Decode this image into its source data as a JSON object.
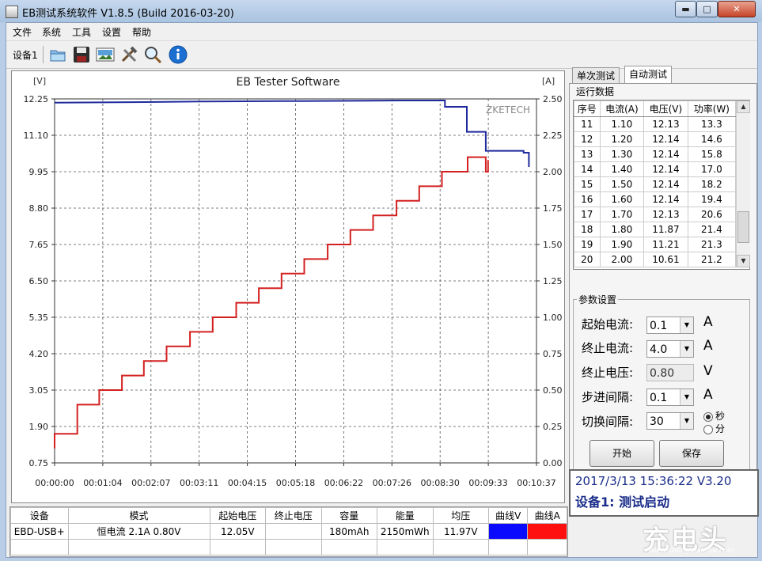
{
  "window": {
    "title": "EB测试系统软件 V1.8.5 (Build 2016-03-20)",
    "min_glyph": "▬",
    "max_glyph": "□",
    "close_glyph": "✕"
  },
  "menu": [
    "文件",
    "系统",
    "工具",
    "设置",
    "帮助"
  ],
  "toolbar": {
    "device_label": "设备1",
    "buttons": [
      "folder-icon",
      "save-icon",
      "image-icon",
      "tools-icon",
      "search-icon",
      "info-icon"
    ]
  },
  "chart_data": {
    "type": "line",
    "title": "EB Tester Software",
    "watermark": "ZKETECH",
    "left_unit": "[V]",
    "right_unit": "[A]",
    "x_tick_labels": [
      "00:00:00",
      "00:01:04",
      "00:02:07",
      "00:03:11",
      "00:04:15",
      "00:05:18",
      "00:06:22",
      "00:07:26",
      "00:08:30",
      "00:09:33",
      "00:10:37"
    ],
    "y_left_ticks": [
      "12.25",
      "11.10",
      "9.95",
      "8.80",
      "7.65",
      "6.50",
      "5.35",
      "4.20",
      "3.05",
      "1.90",
      "0.75"
    ],
    "y_right_ticks": [
      "2.50",
      "2.25",
      "2.00",
      "1.75",
      "1.50",
      "1.25",
      "1.00",
      "0.75",
      "0.50",
      "0.25",
      "0.00"
    ],
    "ylim_left": [
      0.75,
      12.25
    ],
    "ylim_right": [
      0.0,
      2.5
    ],
    "x_range_seconds": [
      0,
      637
    ],
    "series": [
      {
        "name": "曲线V",
        "axis": "left",
        "color": "#1f2a9c",
        "points": [
          [
            0,
            12.13
          ],
          [
            60,
            12.14
          ],
          [
            120,
            12.15
          ],
          [
            200,
            12.17
          ],
          [
            300,
            12.18
          ],
          [
            400,
            12.19
          ],
          [
            460,
            12.2
          ],
          [
            510,
            12.2
          ],
          [
            516,
            12.2
          ],
          [
            516,
            12.0
          ],
          [
            545,
            12.0
          ],
          [
            545,
            11.87
          ],
          [
            545,
            11.21
          ],
          [
            570,
            11.21
          ],
          [
            570,
            10.61
          ],
          [
            620,
            10.61
          ],
          [
            620,
            10.55
          ],
          [
            627,
            10.55
          ],
          [
            627,
            10.1
          ]
        ]
      },
      {
        "name": "曲线A",
        "axis": "right",
        "color": "#d42020",
        "points": [
          [
            0,
            0.1
          ],
          [
            0,
            0.2
          ],
          [
            30,
            0.2
          ],
          [
            30,
            0.4
          ],
          [
            59,
            0.4
          ],
          [
            59,
            0.5
          ],
          [
            89,
            0.5
          ],
          [
            89,
            0.6
          ],
          [
            118,
            0.6
          ],
          [
            118,
            0.7
          ],
          [
            148,
            0.7
          ],
          [
            148,
            0.8
          ],
          [
            179,
            0.8
          ],
          [
            179,
            0.9
          ],
          [
            209,
            0.9
          ],
          [
            209,
            1.0
          ],
          [
            240,
            1.0
          ],
          [
            240,
            1.1
          ],
          [
            270,
            1.1
          ],
          [
            270,
            1.2
          ],
          [
            300,
            1.2
          ],
          [
            300,
            1.3
          ],
          [
            330,
            1.3
          ],
          [
            330,
            1.4
          ],
          [
            361,
            1.4
          ],
          [
            361,
            1.5
          ],
          [
            391,
            1.5
          ],
          [
            391,
            1.6
          ],
          [
            421,
            1.6
          ],
          [
            421,
            1.7
          ],
          [
            452,
            1.7
          ],
          [
            452,
            1.8
          ],
          [
            482,
            1.8
          ],
          [
            482,
            1.9
          ],
          [
            512,
            1.9
          ],
          [
            512,
            2.0
          ],
          [
            546,
            2.0
          ],
          [
            546,
            2.1
          ],
          [
            570,
            2.1
          ],
          [
            570,
            2.0
          ],
          [
            573,
            2.0
          ],
          [
            573,
            2.08
          ]
        ]
      }
    ]
  },
  "tabs": [
    "单次测试",
    "自动测试"
  ],
  "run_data": {
    "title": "运行数据",
    "headers": [
      "序号",
      "电流(A)",
      "电压(V)",
      "功率(W)"
    ],
    "rows": [
      [
        "11",
        "1.10",
        "12.13",
        "13.3"
      ],
      [
        "12",
        "1.20",
        "12.14",
        "14.6"
      ],
      [
        "13",
        "1.30",
        "12.14",
        "15.8"
      ],
      [
        "14",
        "1.40",
        "12.14",
        "17.0"
      ],
      [
        "15",
        "1.50",
        "12.14",
        "18.2"
      ],
      [
        "16",
        "1.60",
        "12.14",
        "19.4"
      ],
      [
        "17",
        "1.70",
        "12.13",
        "20.6"
      ],
      [
        "18",
        "1.80",
        "11.87",
        "21.4"
      ],
      [
        "19",
        "1.90",
        "11.21",
        "21.3"
      ],
      [
        "20",
        "2.00",
        "10.61",
        "21.2"
      ]
    ]
  },
  "params": {
    "title": "参数设置",
    "start_current_label": "起始电流:",
    "start_current_value": "0.1",
    "start_current_unit": "A",
    "end_current_label": "终止电流:",
    "end_current_value": "4.0",
    "end_current_unit": "A",
    "end_voltage_label": "终止电压:",
    "end_voltage_value": "0.80",
    "end_voltage_unit": "V",
    "step_label": "步进间隔:",
    "step_value": "0.1",
    "step_unit": "A",
    "switch_label": "切换间隔:",
    "switch_value": "30",
    "radio_sec": "秒",
    "radio_min": "分",
    "start_button": "开始",
    "save_button": "保存"
  },
  "status": {
    "line1": "2017/3/13 15:36:22  V3.20",
    "line2": "设备1: 测试启动"
  },
  "summary": {
    "headers": [
      "设备",
      "模式",
      "起始电压",
      "终止电压",
      "容量",
      "能量",
      "均压",
      "曲线V",
      "曲线A"
    ],
    "row": [
      "EBD-USB+",
      "恒电流 2.1A 0.80V",
      "12.05V",
      "",
      "180mAh",
      "2150mWh",
      "11.97V",
      "",
      ""
    ],
    "colors": {
      "curveV": "#0a0aff",
      "curveA": "#ff1010"
    }
  },
  "watermark": {
    "brand": "充电头",
    "url": "www.chongdiantou.com"
  }
}
